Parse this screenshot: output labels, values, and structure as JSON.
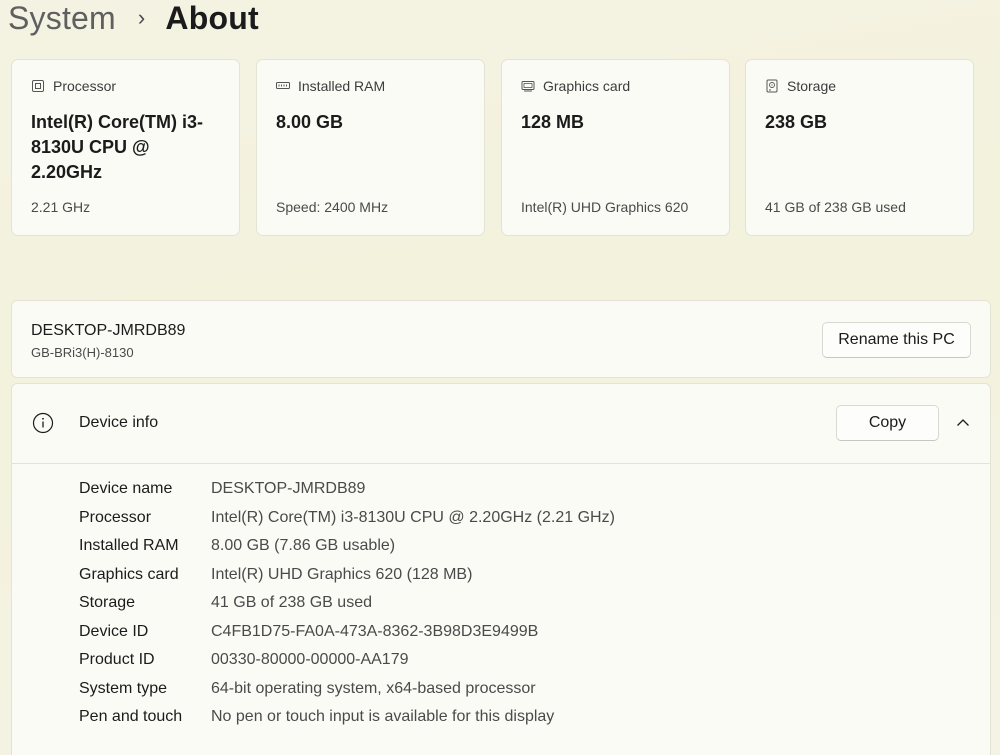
{
  "breadcrumb": {
    "parent": "System",
    "separator": "›",
    "current": "About"
  },
  "cards": [
    {
      "title": "Processor",
      "icon": "processor-icon",
      "value": "Intel(R) Core(TM) i3-8130U CPU @ 2.20GHz",
      "sub": "2.21 GHz"
    },
    {
      "title": "Installed RAM",
      "icon": "ram-icon",
      "value": "8.00 GB",
      "sub": "Speed: 2400 MHz"
    },
    {
      "title": "Graphics card",
      "icon": "graphics-card-icon",
      "value": "128 MB",
      "sub": "Intel(R) UHD Graphics 620"
    },
    {
      "title": "Storage",
      "icon": "storage-icon",
      "value": "238 GB",
      "sub": "41 GB of 238 GB used"
    }
  ],
  "pc": {
    "name": "DESKTOP-JMRDB89",
    "model": "GB-BRi3(H)-8130",
    "rename_label": "Rename this PC"
  },
  "device_info": {
    "title": "Device info",
    "copy_label": "Copy",
    "rows": [
      {
        "label": "Device name",
        "value": "DESKTOP-JMRDB89"
      },
      {
        "label": "Processor",
        "value": "Intel(R) Core(TM) i3-8130U CPU @ 2.20GHz (2.21 GHz)"
      },
      {
        "label": "Installed RAM",
        "value": "8.00 GB (7.86 GB usable)"
      },
      {
        "label": "Graphics card",
        "value": "Intel(R) UHD Graphics 620 (128 MB)"
      },
      {
        "label": "Storage",
        "value": "41 GB of 238 GB used"
      },
      {
        "label": "Device ID",
        "value": "C4FB1D75-FA0A-473A-8362-3B98D3E9499B"
      },
      {
        "label": "Product ID",
        "value": "00330-80000-00000-AA179"
      },
      {
        "label": "System type",
        "value": "64-bit operating system, x64-based processor"
      },
      {
        "label": "Pen and touch",
        "value": "No pen or touch input is available for this display"
      }
    ]
  }
}
